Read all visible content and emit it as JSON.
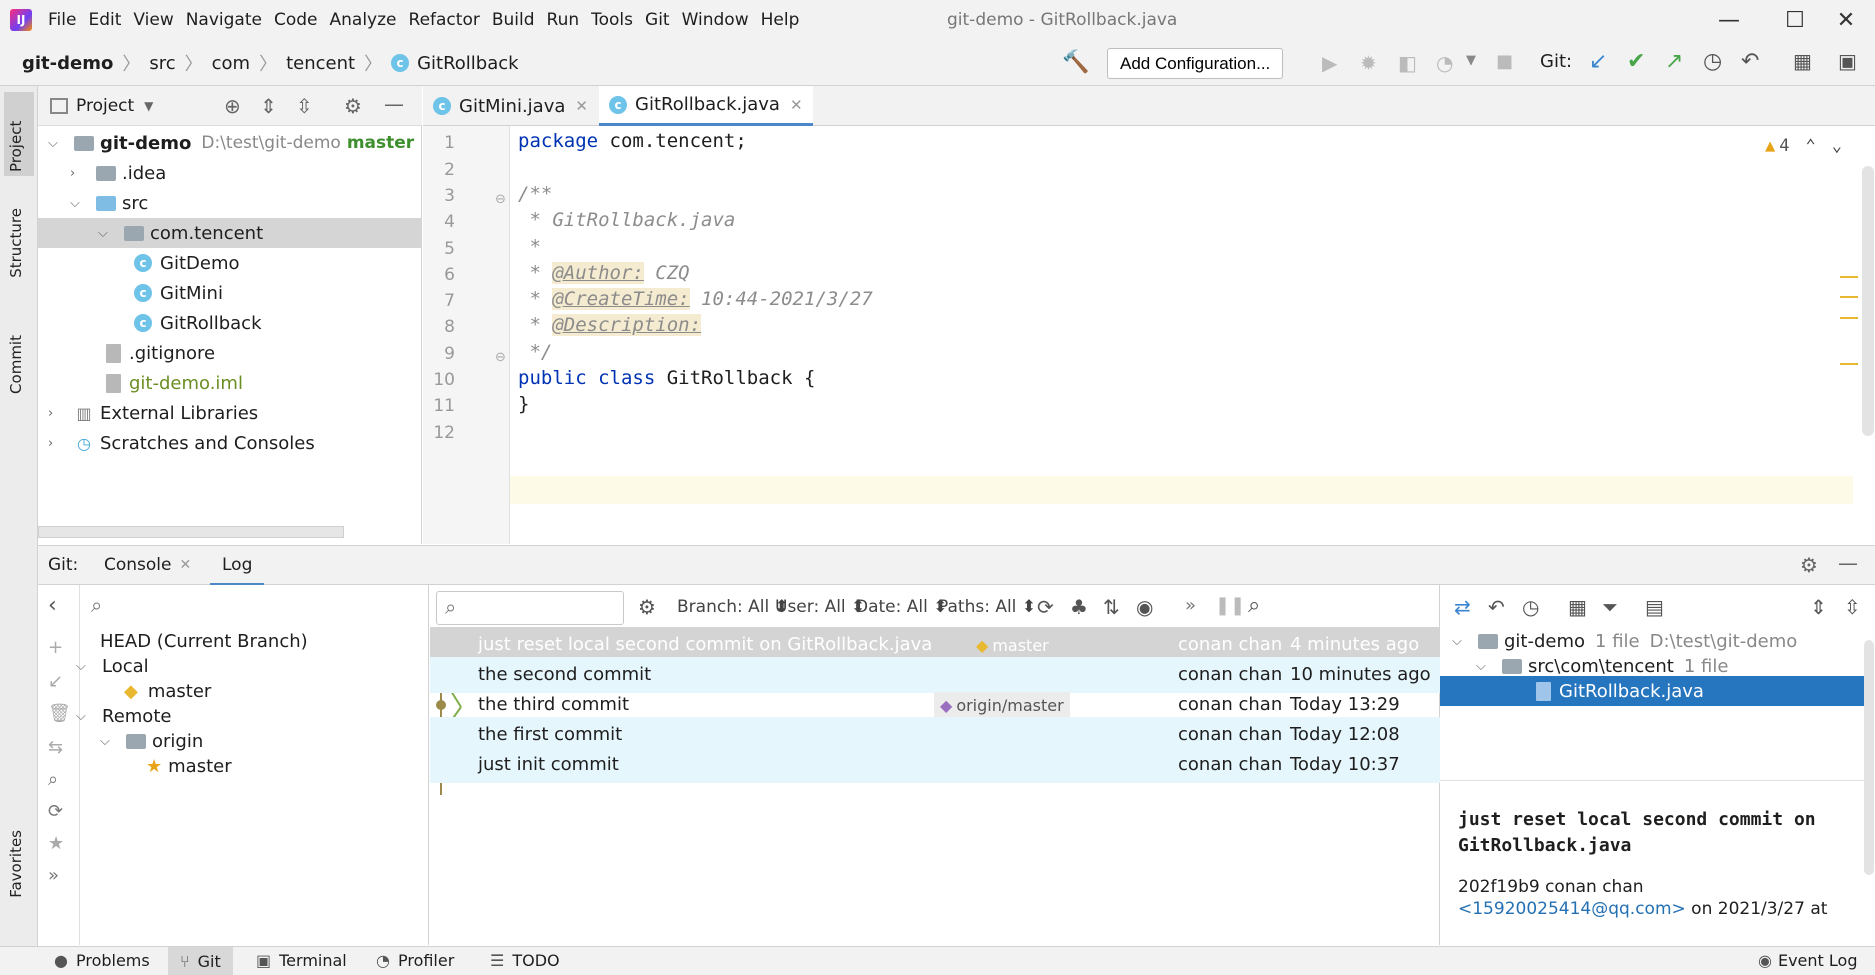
{
  "window": {
    "title": "git-demo - GitRollback.java"
  },
  "menu": [
    "File",
    "Edit",
    "View",
    "Navigate",
    "Code",
    "Analyze",
    "Refactor",
    "Build",
    "Run",
    "Tools",
    "Git",
    "Window",
    "Help"
  ],
  "breadcrumb": [
    "git-demo",
    "src",
    "com",
    "tencent",
    "GitRollback"
  ],
  "toolbar": {
    "add_config": "Add Configuration...",
    "git_label": "Git:"
  },
  "left_stripe": {
    "project": "Project",
    "structure": "Structure",
    "commit": "Commit",
    "favorites": "Favorites"
  },
  "project": {
    "header": "Project",
    "root_name": "git-demo",
    "root_path": "D:\\test\\git-demo",
    "root_branch": "master",
    "items": [
      ".idea",
      "src",
      "com.tencent",
      "GitDemo",
      "GitMini",
      "GitRollback",
      ".gitignore",
      "git-demo.iml",
      "External Libraries",
      "Scratches and Consoles"
    ]
  },
  "editor": {
    "tabs": [
      "GitMini.java",
      "GitRollback.java"
    ],
    "warnings": "4",
    "lines": [
      "1",
      "2",
      "3",
      "4",
      "5",
      "6",
      "7",
      "8",
      "9",
      "10",
      "11",
      "12"
    ],
    "code": {
      "l1_kw": "package",
      "l1_rest": " com.tencent;",
      "l3": "/**",
      "l4": " * GitRollback.java",
      "l5": " *",
      "l6_pre": " * ",
      "l6_tag": "@Author:",
      "l6_val": " CZQ",
      "l7_pre": " * ",
      "l7_tag": "@CreateTime:",
      "l7_val": " 10:44-2021/3/27",
      "l8_pre": " * ",
      "l8_tag": "@Description:",
      "l9": " */",
      "l10_kw": "public class",
      "l10_rest": " GitRollback {",
      "l11": "}"
    }
  },
  "git": {
    "label": "Git:",
    "tabs": [
      "Console",
      "Log"
    ],
    "branches": {
      "head": "HEAD (Current Branch)",
      "local": "Local",
      "local_master": "master",
      "remote": "Remote",
      "origin": "origin",
      "remote_master": "master"
    },
    "filters": {
      "branch": "Branch: All",
      "user": "User: All",
      "date": "Date: All",
      "paths": "Paths: All"
    },
    "commits": [
      {
        "msg": "just reset local second commit on GitRollback.java",
        "ref": "master",
        "author": "conan chan",
        "date": "4 minutes ago"
      },
      {
        "msg": "the second commit",
        "ref": "",
        "author": "conan chan",
        "date": "10 minutes ago"
      },
      {
        "msg": "the third commit",
        "ref": "origin/master",
        "author": "conan chan",
        "date": "Today 13:29"
      },
      {
        "msg": "the first commit",
        "ref": "",
        "author": "conan chan",
        "date": "Today 12:08"
      },
      {
        "msg": "just init commit",
        "ref": "",
        "author": "conan chan",
        "date": "Today 10:37"
      }
    ],
    "changes": {
      "root": "git-demo",
      "root_count": "1 file",
      "root_path": "D:\\test\\git-demo",
      "dir": "src\\com\\tencent",
      "dir_count": "1 file",
      "file": "GitRollback.java"
    },
    "details": {
      "message": "just reset local second commit on GitRollback.java",
      "hash_author": "202f19b9 conan chan",
      "email": "<15920025414@qq.com>",
      "date_text": " on 2021/3/27 at"
    }
  },
  "statusbar": {
    "problems": "Problems",
    "git": "Git",
    "terminal": "Terminal",
    "profiler": "Profiler",
    "todo": "TODO",
    "event_log": "Event Log"
  },
  "colors": {
    "accent": "#4a88c7",
    "graph": "#9c8a4a",
    "graph_green": "#7fae4a",
    "selected": "#d4d4d4",
    "highlight": "#e5f6fc"
  }
}
